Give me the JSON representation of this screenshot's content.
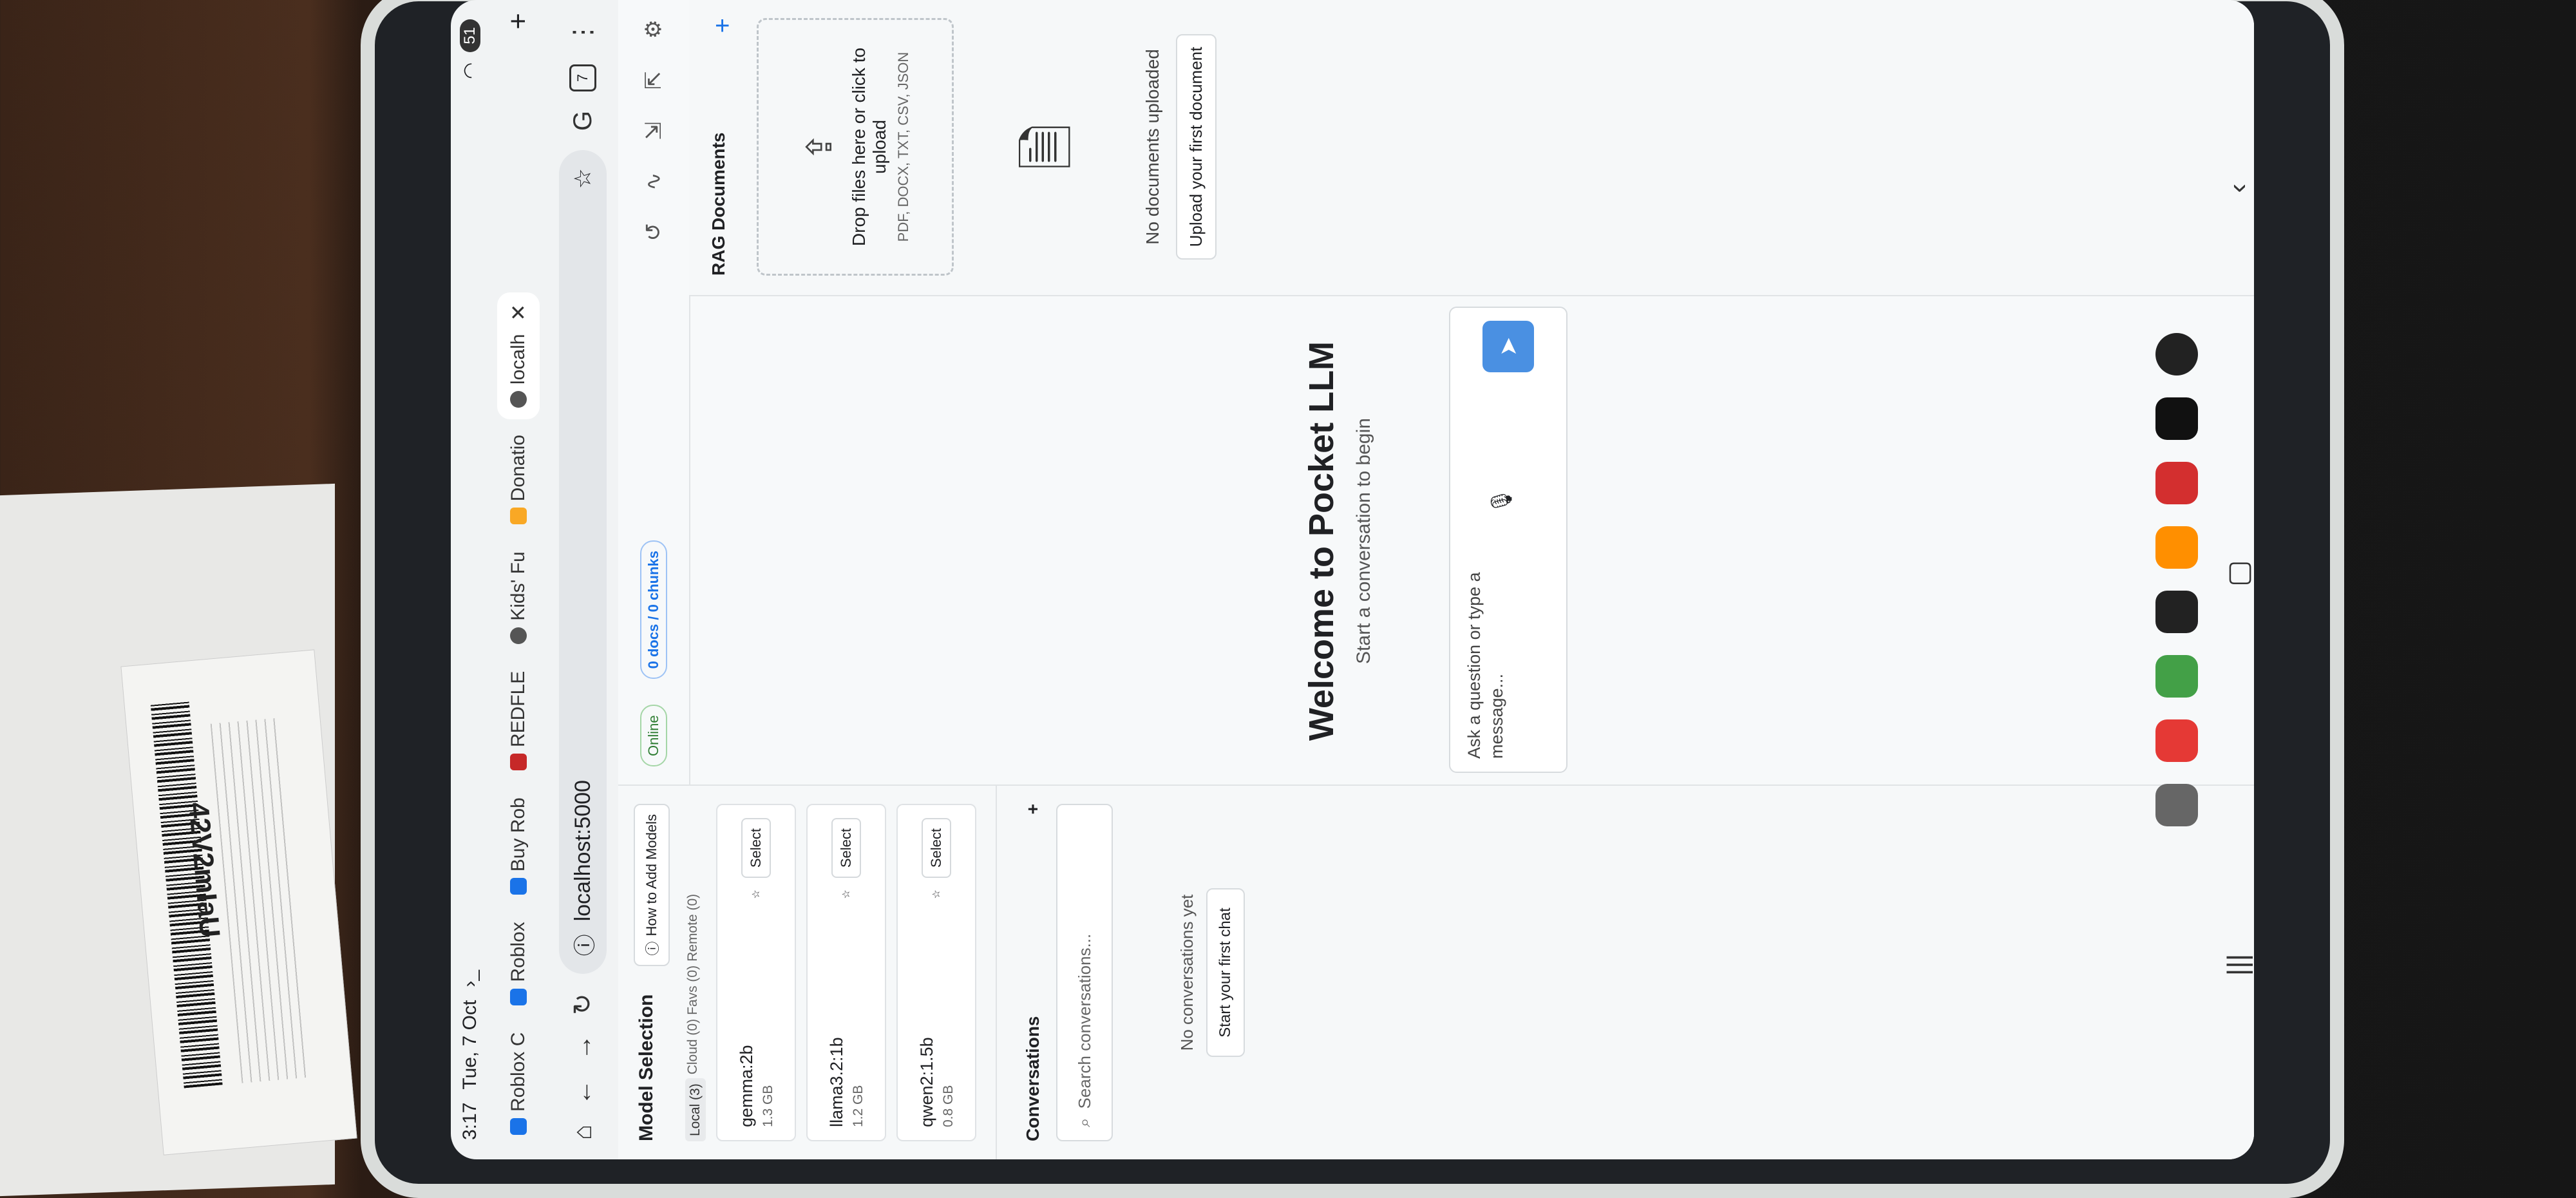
{
  "status": {
    "time": "3:17",
    "date": "Tue, 7 Oct",
    "battery": "51"
  },
  "tabs": [
    {
      "title": "Roblox C",
      "active": false
    },
    {
      "title": "Roblox",
      "active": false
    },
    {
      "title": "Buy Rob",
      "active": false
    },
    {
      "title": "REDFLE",
      "active": false
    },
    {
      "title": "Kids' Fu",
      "active": false
    },
    {
      "title": "Donatio",
      "active": false
    },
    {
      "title": "localh",
      "active": true
    }
  ],
  "url": "localhost:5000",
  "tab_count": "7",
  "sidebar": {
    "title": "Model Selection",
    "how_to": "How to Add Models",
    "filters": [
      "Local (3)",
      "Cloud (0)",
      "Favs (0)",
      "Remote (0)"
    ],
    "models": [
      {
        "name": "gemma:2b",
        "size": "1.3 GB",
        "select": "Select"
      },
      {
        "name": "llama3.2:1b",
        "size": "1.2 GB",
        "select": "Select"
      },
      {
        "name": "qwen2:1.5b",
        "size": "0.8 GB",
        "select": "Select"
      }
    ],
    "conversations_title": "Conversations",
    "search_placeholder": "Search conversations...",
    "no_conversations": "No conversations yet",
    "start_chat": "Start your first chat"
  },
  "topbar": {
    "online": "Online",
    "chunks": "0 docs / 0 chunks"
  },
  "chat": {
    "welcome_title": "Welcome to Pocket LLM",
    "welcome_sub": "Start a conversation to begin",
    "input_placeholder": "Ask a question or type a message..."
  },
  "rag": {
    "title": "RAG Documents",
    "drop_text": "Drop files here or click to upload",
    "formats": "PDF, DOCX, TXT, CSV, JSON",
    "no_docs": "No documents uploaded",
    "upload_first": "Upload your first document"
  },
  "label": {
    "code": "42V2mIaU"
  },
  "colors": {
    "accent": "#1a73e8",
    "online": "#2e7d32",
    "send": "#4a90e2"
  }
}
